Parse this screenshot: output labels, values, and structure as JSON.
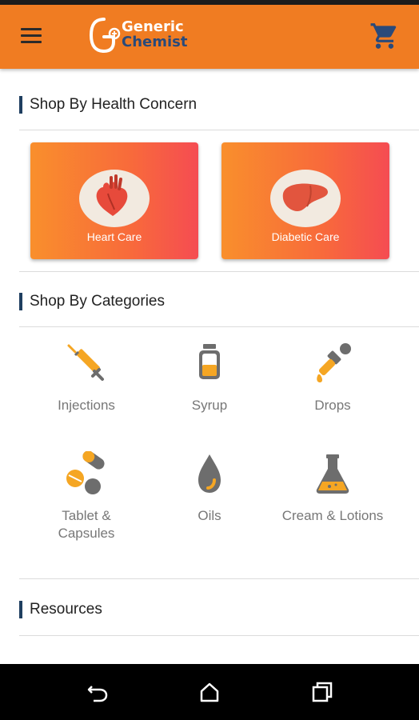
{
  "app": {
    "logo_line1": "Generic",
    "logo_line2": "Chemist"
  },
  "icons": {
    "menu": "hamburger-menu-icon",
    "cart": "shopping-cart-icon",
    "back": "back-icon",
    "home": "home-icon",
    "recents": "recents-icon"
  },
  "colors": {
    "appbar": "#f07c22",
    "accent_bar": "#1f3f60",
    "card_gradient_start": "#f98f2c",
    "card_gradient_end": "#f54c52",
    "icon_orange": "#f5a623",
    "icon_gray": "#6d6d6d"
  },
  "health": {
    "title": "Shop By Health Concern",
    "cards": [
      {
        "label": "Heart Care",
        "icon": "heart-organ-icon"
      },
      {
        "label": "Diabetic Care",
        "icon": "liver-organ-icon"
      }
    ]
  },
  "categories": {
    "title": "Shop By Categories",
    "items": [
      {
        "label": "Injections",
        "icon": "syringe-icon"
      },
      {
        "label": "Syrup",
        "icon": "syrup-bottle-icon"
      },
      {
        "label": "Drops",
        "icon": "dropper-icon"
      },
      {
        "label": "Tablet &\nCapsules",
        "icon": "pills-icon"
      },
      {
        "label": "Oils",
        "icon": "oil-drop-icon"
      },
      {
        "label": "Cream & Lotions",
        "icon": "flask-icon"
      }
    ]
  },
  "resources": {
    "title": "Resources"
  }
}
